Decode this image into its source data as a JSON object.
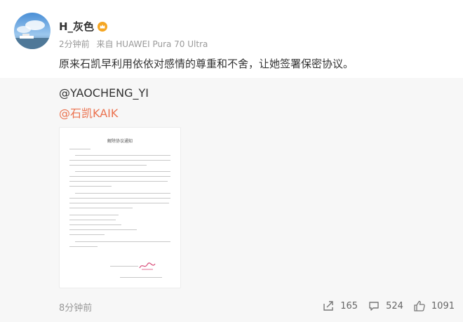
{
  "post": {
    "username": "H_灰色",
    "badge_icon": "vip-crown-icon",
    "time": "2分钟前",
    "source": "来自 HUAWEI Pura 70 Ultra",
    "text": "原来石凯早利用依依对感情的尊重和不舍，让她签署保密协议。"
  },
  "repost": {
    "author": "@YAOCHENG_YI",
    "mention": "@石凯KAIK",
    "document_title": "解除协议通知",
    "time": "8分钟前",
    "actions": {
      "share_icon": "share-icon",
      "share_count": "165",
      "comment_icon": "comment-icon",
      "comment_count": "524",
      "like_icon": "like-icon",
      "like_count": "1091"
    }
  },
  "colors": {
    "accent": "#eb7350",
    "repost_bg": "#f7f7f7"
  }
}
